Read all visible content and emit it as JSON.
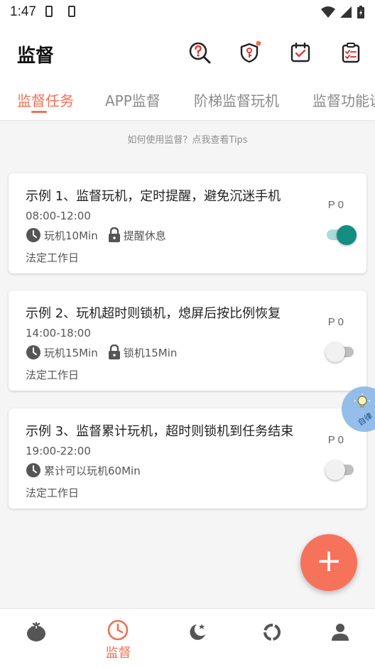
{
  "status_bar": {
    "time": "1:47"
  },
  "app_bar": {
    "title": "监督",
    "icons": [
      "help-search-icon",
      "shield-key-icon",
      "calendar-check-icon",
      "clipboard-list-icon"
    ]
  },
  "tabs": [
    {
      "label": "监督任务",
      "active": true
    },
    {
      "label": "APP监督",
      "active": false
    },
    {
      "label": "阶梯监督玩机",
      "active": false
    },
    {
      "label": "监督功能说",
      "active": false
    }
  ],
  "tips": "如何使用监督？点我查看Tips",
  "tasks": [
    {
      "title": "示例 1、监督玩机，定时提醒，避免沉迷手机",
      "time": "08:00-12:00",
      "meta": [
        {
          "icon": "clock-icon",
          "text": "玩机10Min"
        },
        {
          "icon": "lock-icon",
          "text": "提醒休息"
        }
      ],
      "days": "法定工作日",
      "priority": "P 0",
      "enabled": true
    },
    {
      "title": "示例 2、玩机超时则锁机，熄屏后按比例恢复",
      "time": "14:00-18:00",
      "meta": [
        {
          "icon": "clock-icon",
          "text": "玩机15Min"
        },
        {
          "icon": "lock-icon",
          "text": "锁机15Min"
        }
      ],
      "days": "法定工作日",
      "priority": "P 0",
      "enabled": false
    },
    {
      "title": "示例 3、监督累计玩机，超时则锁机到任务结束",
      "time": "19:00-22:00",
      "meta": [
        {
          "icon": "clock-icon",
          "text": "累计可以玩机60Min"
        }
      ],
      "days": "法定工作日",
      "priority": "P 0",
      "enabled": false
    }
  ],
  "floating_tip": {
    "label": "自律"
  },
  "fab": {
    "label": "+"
  },
  "bottom_nav": [
    {
      "icon": "tomato-icon",
      "label": "",
      "active": false
    },
    {
      "icon": "clock-icon",
      "label": "监督",
      "active": true
    },
    {
      "icon": "moon-star-icon",
      "label": "",
      "active": false
    },
    {
      "icon": "ring-chart-icon",
      "label": "",
      "active": false
    },
    {
      "icon": "person-icon",
      "label": "",
      "active": false
    }
  ],
  "colors": {
    "accent": "#f27055",
    "toggle_on": "#138e83",
    "fab": "#f6725b"
  }
}
